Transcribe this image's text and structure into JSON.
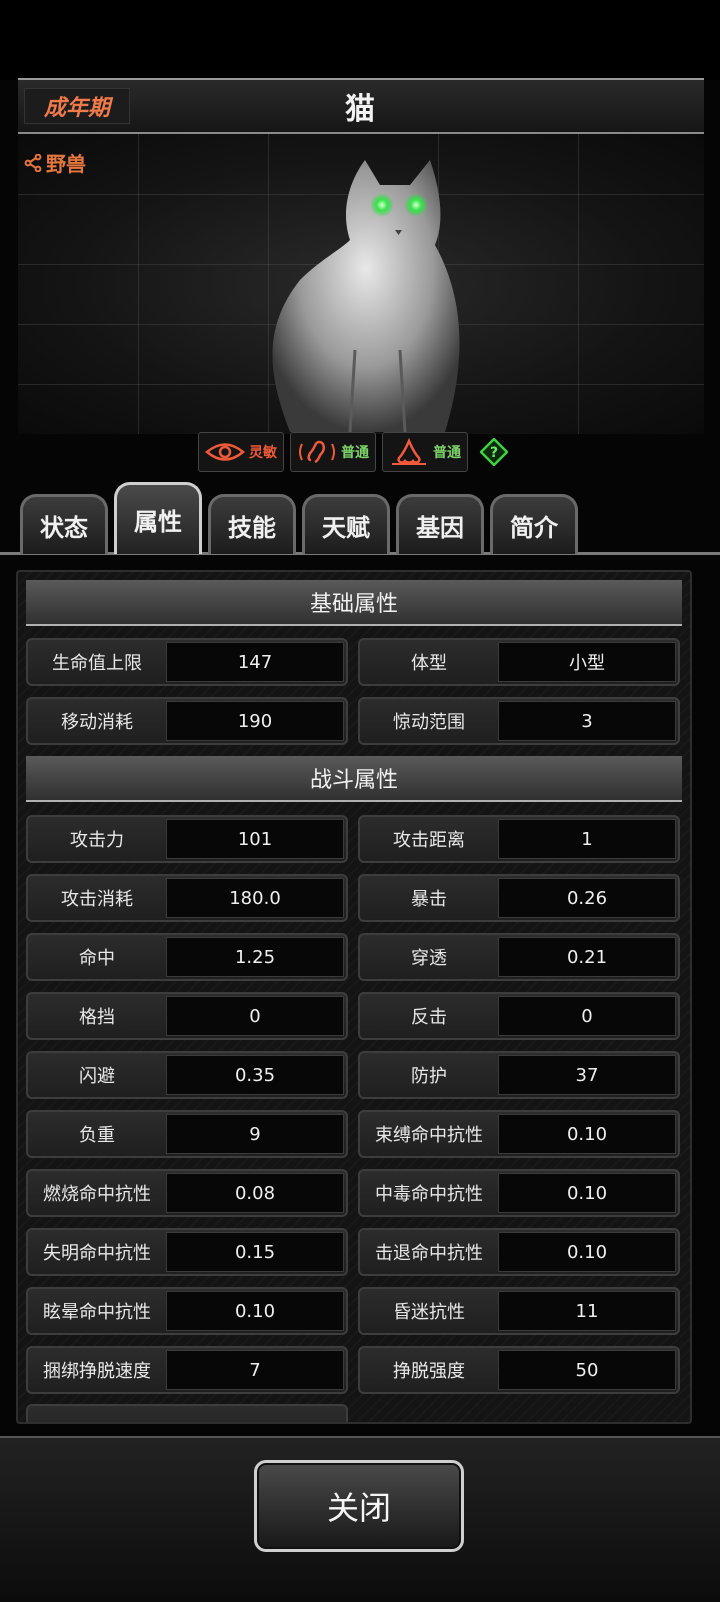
{
  "header": {
    "stage": "成年期",
    "title": "猫"
  },
  "family": {
    "label": "野兽",
    "icon": "share-icon"
  },
  "traits": [
    {
      "icon": "eye-icon",
      "label": "灵敏",
      "color": "#f05a3a"
    },
    {
      "icon": "ear-icon",
      "label": "普通",
      "color": "#7dd36a"
    },
    {
      "icon": "nose-icon",
      "label": "普通",
      "color": "#7dd36a"
    }
  ],
  "help_icon": "question-diamond-icon",
  "tabs": [
    {
      "label": "状态",
      "active": false
    },
    {
      "label": "属性",
      "active": true
    },
    {
      "label": "技能",
      "active": false
    },
    {
      "label": "天赋",
      "active": false
    },
    {
      "label": "基因",
      "active": false
    },
    {
      "label": "简介",
      "active": false
    }
  ],
  "sections": {
    "basic": "基础属性",
    "combat": "战斗属性"
  },
  "basic": [
    {
      "k": "生命值上限",
      "v": "147"
    },
    {
      "k": "体型",
      "v": "小型"
    },
    {
      "k": "移动消耗",
      "v": "190"
    },
    {
      "k": "惊动范围",
      "v": "3"
    }
  ],
  "combat": [
    {
      "k": "攻击力",
      "v": "101"
    },
    {
      "k": "攻击距离",
      "v": "1"
    },
    {
      "k": "攻击消耗",
      "v": "180.0"
    },
    {
      "k": "暴击",
      "v": "0.26"
    },
    {
      "k": "命中",
      "v": "1.25"
    },
    {
      "k": "穿透",
      "v": "0.21"
    },
    {
      "k": "格挡",
      "v": "0"
    },
    {
      "k": "反击",
      "v": "0"
    },
    {
      "k": "闪避",
      "v": "0.35"
    },
    {
      "k": "防护",
      "v": "37"
    },
    {
      "k": "负重",
      "v": "9"
    },
    {
      "k": "束缚命中抗性",
      "v": "0.10"
    },
    {
      "k": "燃烧命中抗性",
      "v": "0.08"
    },
    {
      "k": "中毒命中抗性",
      "v": "0.10"
    },
    {
      "k": "失明命中抗性",
      "v": "0.15"
    },
    {
      "k": "击退命中抗性",
      "v": "0.10"
    },
    {
      "k": "眩晕命中抗性",
      "v": "0.10"
    },
    {
      "k": "昏迷抗性",
      "v": "11"
    },
    {
      "k": "捆绑挣脱速度",
      "v": "7"
    },
    {
      "k": "挣脱强度",
      "v": "50"
    }
  ],
  "close_label": "关闭"
}
